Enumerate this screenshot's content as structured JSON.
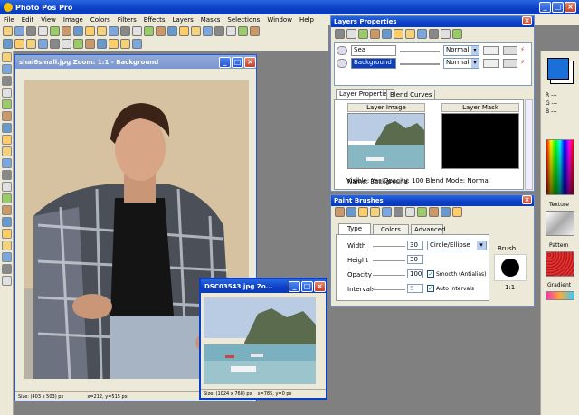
{
  "app": {
    "title": "Photo Pos Pro"
  },
  "menu": [
    "File",
    "Edit",
    "View",
    "Image",
    "Colors",
    "Filters",
    "Effects",
    "Layers",
    "Masks",
    "Selections",
    "Window",
    "Help"
  ],
  "doc1": {
    "title": "shai6small.jpg  Zoom: 1:1 - Background",
    "status_size": "Size: (403 x 503) px",
    "status_pos": "x=212, y=515 px"
  },
  "doc2": {
    "title": "DSC03543.jpg  Zo...",
    "status_size": "Size: (1024 x 768) px",
    "status_pos": "x=785, y=0 px"
  },
  "layers": {
    "title": "Layers Properties",
    "rows": [
      {
        "name": "Sea",
        "mode": "Normal"
      },
      {
        "name": "Background",
        "mode": "Normal"
      }
    ],
    "tabs": [
      "Layer Properties",
      "Blend Curves"
    ],
    "image_label": "Layer Image",
    "mask_label": "Layer Mask",
    "name_line": "Name:  Background",
    "props_line": "Visible: Yes   Opacity: 100   Blend Mode: Normal"
  },
  "brushes": {
    "title": "Paint Brushes",
    "tabs": [
      "Type",
      "Colors",
      "Advanced"
    ],
    "width_label": "Width",
    "width_value": "30",
    "shape": "Circle/Ellipse",
    "height_label": "Height",
    "height_value": "30",
    "opacity_label": "Opacity",
    "opacity_value": "100",
    "smooth_label": "Smooth (Antialias)",
    "intervals_label": "Intervals",
    "intervals_value": "5",
    "auto_label": "Auto Intervals",
    "brush_label": "Brush",
    "ratio": "1:1"
  },
  "color_panel": {
    "r": "R ---",
    "g": "G ---",
    "b": "B ---",
    "texture": "Texture",
    "pattern": "Pattern",
    "gradient": "Gradient"
  },
  "colors": {
    "fg": "#1a6fd8",
    "accent": "#0a3fc4"
  }
}
